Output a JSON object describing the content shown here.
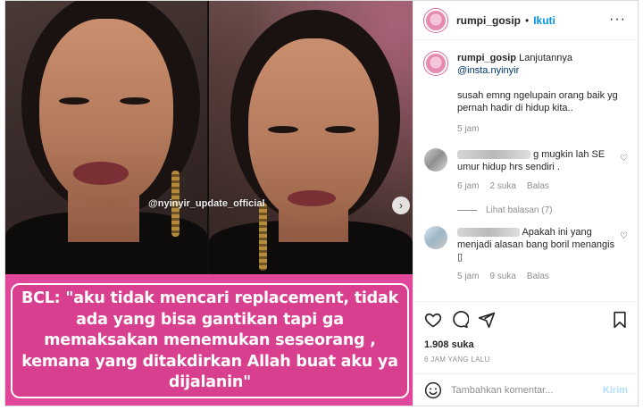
{
  "media": {
    "watermark": "@nyinyir_update_official",
    "next_glyph": "›",
    "caption": "BCL: \"aku tidak mencari replacement, tidak ada yang bisa gantikan tapi ga memaksakan menemukan seseorang , kemana yang ditakdirkan Allah buat aku ya dijalanin\""
  },
  "header": {
    "username": "rumpi_gosip",
    "separator": "•",
    "follow_label": "Ikuti",
    "more_glyph": "···"
  },
  "caption_post": {
    "username": "rumpi_gosip",
    "text_before": "Lanjutannya",
    "mention": "@insta.nyinyir",
    "body": "susah emng ngelupain orang baik yg pernah hadir di hidup kita..",
    "time": "5 jam"
  },
  "comments": [
    {
      "text": "g mugkin lah SE umur hidup hrs sendiri .",
      "time": "6 jam",
      "likes": "2 suka",
      "reply_label": "Balas",
      "view_replies": "Lihat balasan (7)"
    },
    {
      "text": "Apakah ini yang menjadi alasan bang boril menangis ▯",
      "time": "5 jam",
      "likes": "9 suka",
      "reply_label": "Balas"
    }
  ],
  "actions": {
    "likes": "1.908 suka",
    "posted": "6 JAM YANG LALU"
  },
  "add_comment": {
    "placeholder": "Tambahkan komentar...",
    "post_label": "Kirim"
  },
  "colors": {
    "accent": "#0095f6",
    "caption_bg": "#e0479a",
    "post_disabled": "#b2dffc"
  }
}
